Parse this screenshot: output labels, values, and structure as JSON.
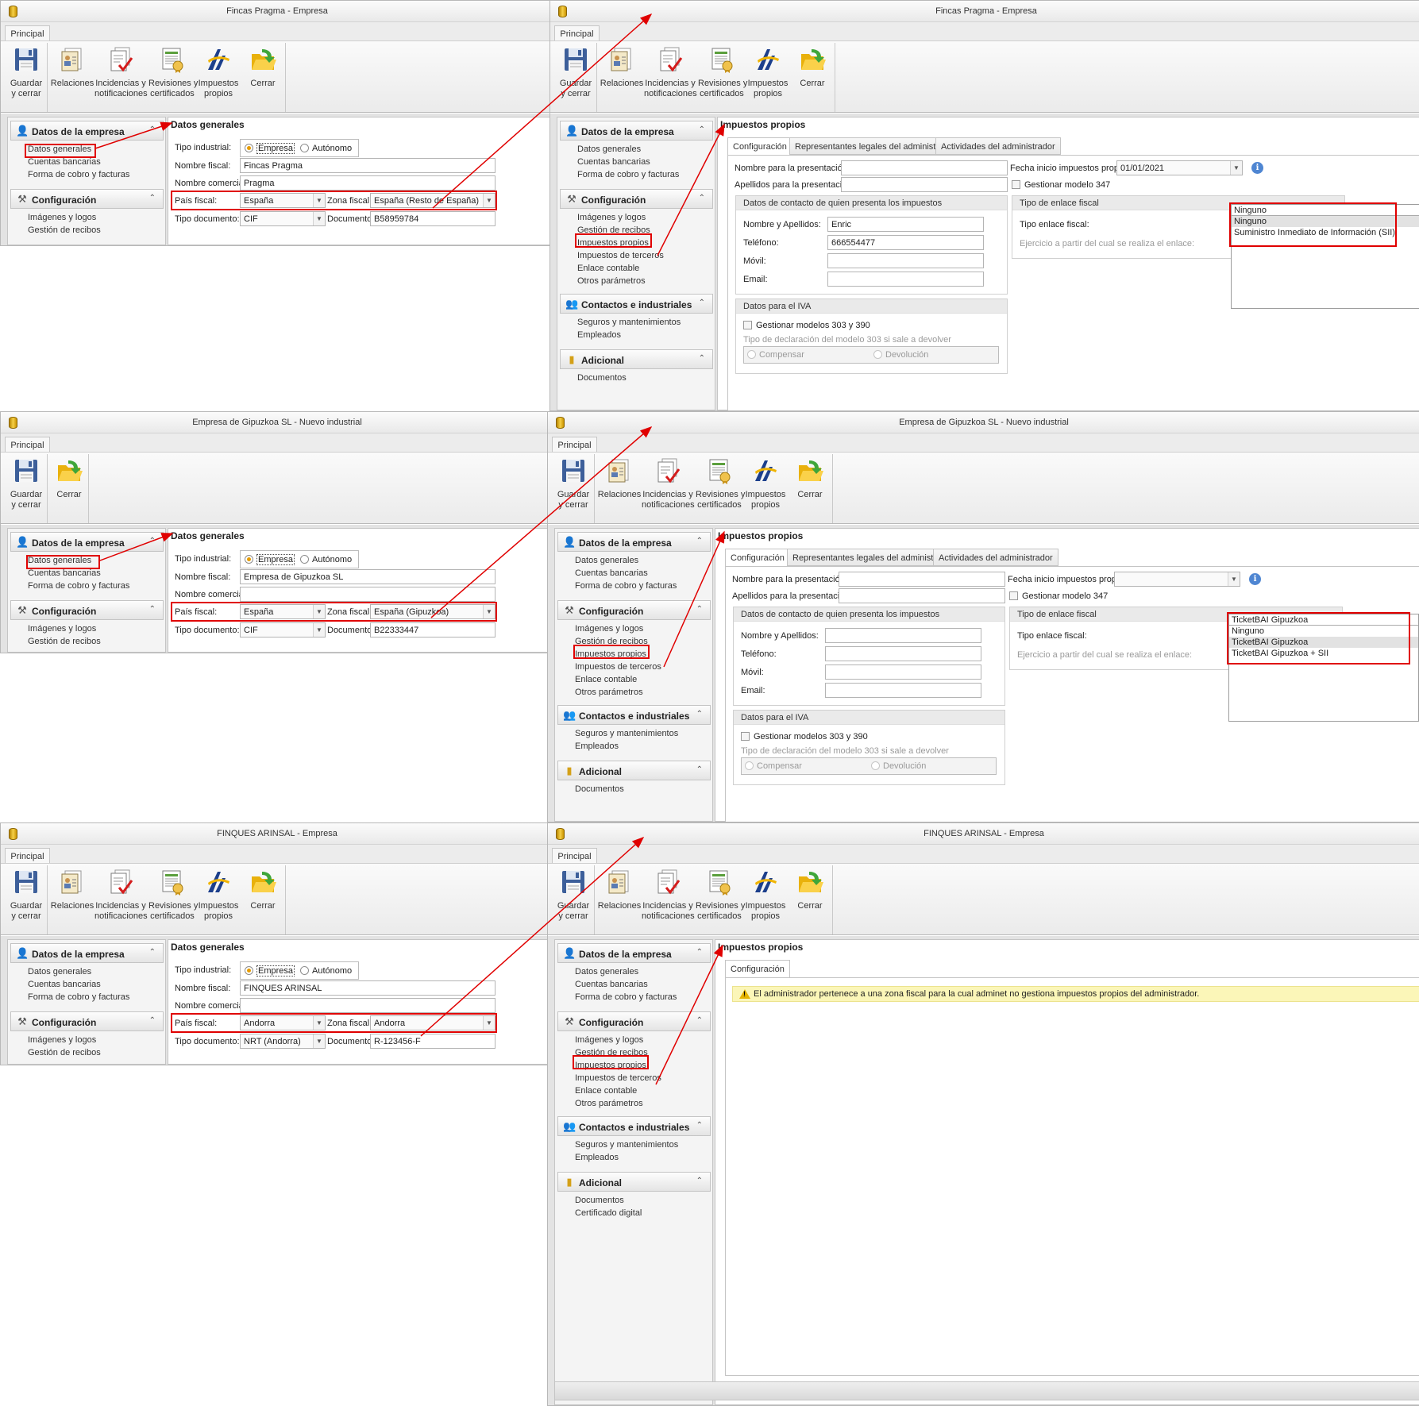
{
  "ribbon": {
    "tab": "Principal",
    "guardar": [
      "Guardar",
      "y cerrar"
    ],
    "relaciones": [
      "Relaciones",
      ""
    ],
    "incidencias": [
      "Incidencias y",
      "notificaciones"
    ],
    "revisiones": [
      "Revisiones y",
      "certificados"
    ],
    "impuestos": [
      "Impuestos",
      "propios"
    ],
    "cerrar": [
      "Cerrar",
      ""
    ]
  },
  "nav": {
    "datos_empresa": "Datos de la empresa",
    "datos_generales": "Datos generales",
    "cuentas_bancarias": "Cuentas bancarias",
    "forma_cobro": "Forma de cobro y facturas",
    "configuracion": "Configuración",
    "imagenes": "Imágenes y logos",
    "gestion_recibos": "Gestión de recibos",
    "impuestos_propios": "Impuestos propios",
    "impuestos_terceros": "Impuestos de terceros",
    "enlace_contable": "Enlace contable",
    "otros_parametros": "Otros parámetros",
    "contactos": "Contactos e industriales",
    "seguros": "Seguros y mantenimientos",
    "empleados": "Empleados",
    "adicional": "Adicional",
    "documentos": "Documentos",
    "certificado": "Certificado digital"
  },
  "dg": {
    "title": "Datos generales",
    "tipo_industrial": "Tipo industrial:",
    "empresa": "Empresa",
    "autonomo": "Autónomo",
    "nombre_fiscal": "Nombre fiscal:",
    "nombre_comercial": "Nombre comercial:",
    "pais_fiscal": "País fiscal:",
    "zona_fiscal": "Zona fiscal:",
    "tipo_documento": "Tipo documento:",
    "documento": "Documento:"
  },
  "ip": {
    "title": "Impuestos propios",
    "tab_config": "Configuración",
    "tab_representantes": "Representantes legales del administrador",
    "tab_actividades": "Actividades del administrador",
    "nombre_pres": "Nombre para la presentación:",
    "apellidos_pres": "Apellidos para la presentación:",
    "fecha_inicio": "Fecha inicio impuestos propios:",
    "gestionar_347": "Gestionar modelo 347",
    "contacto_title": "Datos de contacto de quien presenta los impuestos",
    "nombre_apellidos": "Nombre y Apellidos:",
    "telefono": "Teléfono:",
    "movil": "Móvil:",
    "email": "Email:",
    "enlace_title": "Tipo de enlace fiscal",
    "tipo_enlace": "Tipo enlace fiscal:",
    "ejercicio": "Ejercicio a partir del cual se realiza el enlace:",
    "iva_title": "Datos para el IVA",
    "gestionar_303": "Gestionar modelos 303 y 390",
    "tipo_decl": "Tipo de declaración del modelo 303 si sale a devolver",
    "compensar": "Compensar",
    "devolucion": "Devolución",
    "warning": "El administrador pertenece a una zona fiscal para la cual adminet no gestiona impuestos propios del administrador."
  },
  "cases": [
    {
      "left_title": "Fincas Pragma - Empresa",
      "right_title": "Fincas Pragma - Empresa",
      "nombre_fiscal": "Fincas Pragma",
      "nombre_comercial": "Pragma",
      "pais": "España",
      "zona": "España (Resto de España)",
      "tipo_doc": "CIF",
      "documento": "B58959784",
      "fecha": "01/01/2021",
      "contacto_nombre": "Enric",
      "contacto_tel": "666554477",
      "enlace_value": "Ninguno",
      "enlace_options": [
        "Ninguno",
        "Suministro Inmediato de Información (SII)"
      ]
    },
    {
      "left_title": "Empresa de Gipuzkoa SL - Nuevo industrial",
      "right_title": "Empresa de Gipuzkoa SL - Nuevo industrial",
      "nombre_fiscal": "Empresa de Gipuzkoa SL",
      "nombre_comercial": "",
      "pais": "España",
      "zona": "España (Gipuzkoa)",
      "tipo_doc": "CIF",
      "documento": "B22333447",
      "fecha": "",
      "contacto_nombre": "",
      "contacto_tel": "",
      "enlace_value": "TicketBAI Gipuzkoa",
      "enlace_options": [
        "Ninguno",
        "TicketBAI Gipuzkoa",
        "TicketBAI Gipuzkoa + SII"
      ]
    },
    {
      "left_title": "FINQUES ARINSAL - Empresa",
      "right_title": "FINQUES ARINSAL - Empresa",
      "nombre_fiscal": "FINQUES ARINSAL",
      "nombre_comercial": "",
      "pais": "Andorra",
      "zona": "Andorra",
      "tipo_doc": "NRT (Andorra)",
      "documento": "R-123456-F"
    }
  ],
  "colors": {
    "highlight": "#e00000",
    "accent": "#e69b00",
    "warning_bg": "#fbf6b8"
  },
  "icons": [
    "floppy-disk-icon",
    "relations-icon",
    "incidents-icon",
    "certificates-icon",
    "tax-agency-icon",
    "folder-close-icon",
    "user-icon",
    "tools-icon",
    "contacts-icon",
    "cylinder-icon",
    "warning-icon",
    "info-icon",
    "app-icon"
  ]
}
